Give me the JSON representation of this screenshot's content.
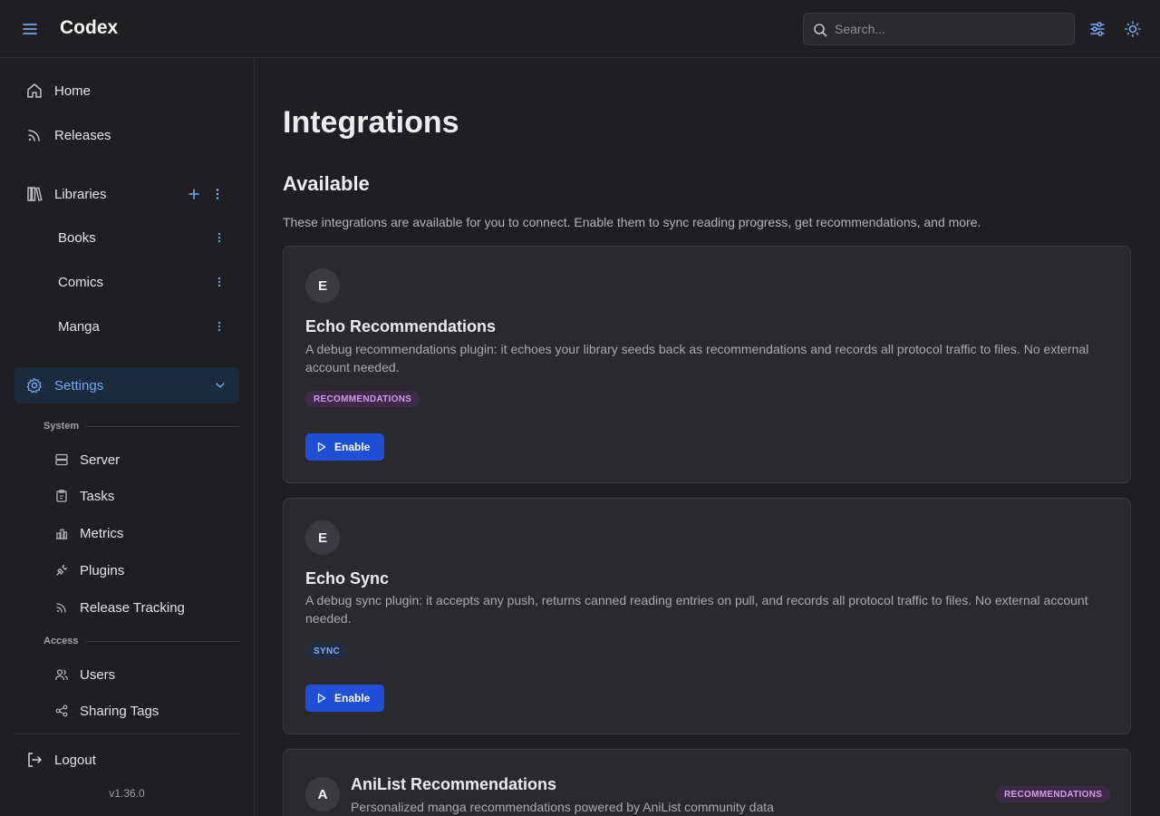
{
  "header": {
    "app_title": "Codex",
    "search_placeholder": "Search..."
  },
  "sidebar": {
    "home": "Home",
    "releases": "Releases",
    "libraries": "Libraries",
    "library_items": [
      "Books",
      "Comics",
      "Manga"
    ],
    "settings": "Settings",
    "system_label": "System",
    "system_items": [
      "Server",
      "Tasks",
      "Metrics",
      "Plugins",
      "Release Tracking"
    ],
    "access_label": "Access",
    "access_items": [
      "Users",
      "Sharing Tags"
    ],
    "logout": "Logout",
    "version": "v1.36.0"
  },
  "main": {
    "title": "Integrations",
    "section_title": "Available",
    "section_desc": "These integrations are available for you to connect. Enable them to sync reading progress, get recommendations, and more.",
    "cards": [
      {
        "initial": "E",
        "title": "Echo Recommendations",
        "desc": "A debug recommendations plugin: it echoes your library seeds back as recommendations and records all protocol traffic to files. No external account needed.",
        "badge": "RECOMMENDATIONS",
        "button": "Enable"
      },
      {
        "initial": "E",
        "title": "Echo Sync",
        "desc": "A debug sync plugin: it accepts any push, returns canned reading entries on pull, and records all protocol traffic to files. No external account needed.",
        "badge": "SYNC",
        "button": "Enable"
      },
      {
        "initial": "A",
        "title": "AniList Recommendations",
        "desc": "Personalized manga recommendations powered by AniList community data",
        "badge": "RECOMMENDATIONS"
      }
    ]
  },
  "colors": {
    "accent": "#74a9f5",
    "primary_button": "#1f4fd6",
    "background": "#1f1f22",
    "card": "#2a2a2e"
  }
}
